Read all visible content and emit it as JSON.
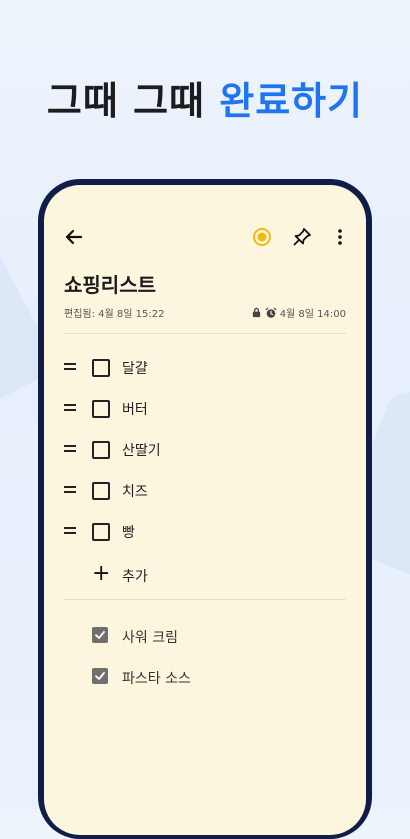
{
  "headline": {
    "part1": "그때 그때",
    "part2": "완료하기"
  },
  "colors": {
    "accent": "#1f74f0",
    "note_bg": "#fdf6de",
    "phone_frame": "#0f1d47",
    "reminder_dot": "#f3b912"
  },
  "toolbar": {
    "icons": [
      "back-arrow-icon",
      "color-dot-icon",
      "pin-icon",
      "more-vert-icon"
    ]
  },
  "note": {
    "title": "쇼핑리스트",
    "edited": "편집됨: 4월 8일 15:22",
    "reminder": "4월 8일 14:00",
    "items": [
      "달걀",
      "버터",
      "산딸기",
      "치즈",
      "빵"
    ],
    "add_label": "추가",
    "checked_items": [
      "사워 크림",
      "파스타 소스"
    ]
  }
}
